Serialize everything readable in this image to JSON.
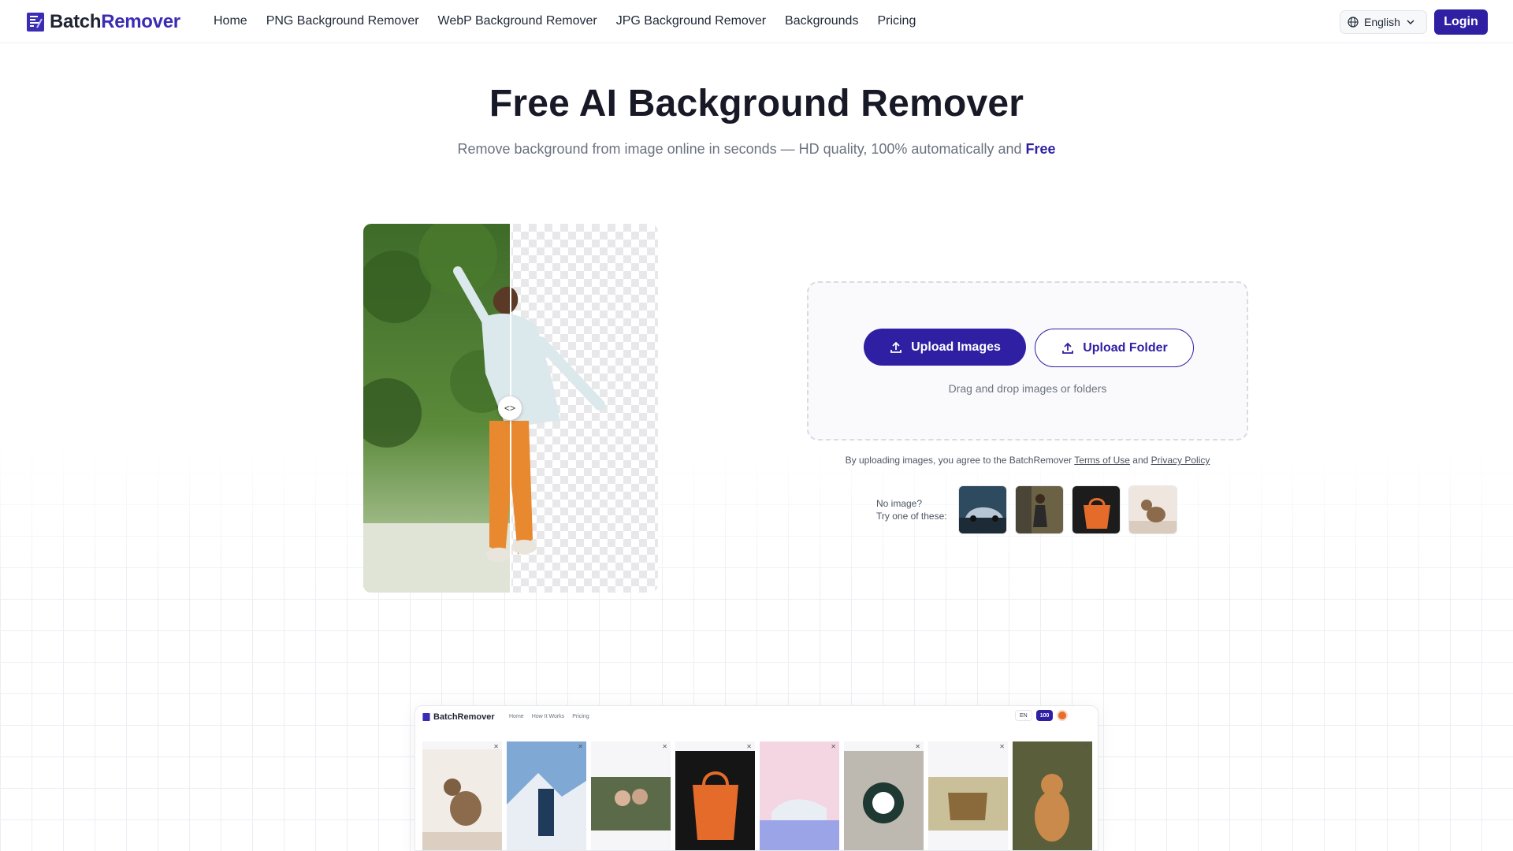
{
  "nav": {
    "logo_part1": "Batch",
    "logo_part2": "Remover",
    "links": [
      "Home",
      "PNG Background Remover",
      "WebP Background Remover",
      "JPG Background Remover",
      "Backgrounds",
      "Pricing"
    ],
    "language": "English",
    "login": "Login"
  },
  "hero": {
    "title": "Free AI Background Remover",
    "subtitle": "Remove background from image online in seconds — HD quality, 100% automatically and",
    "subtitle_highlight": "Free"
  },
  "upload": {
    "upload_images": "Upload Images",
    "upload_folder": "Upload Folder",
    "hint": "Drag and drop images or folders",
    "terms_prefix": "By uploading images, you agree to the BatchRemover",
    "terms_link": "Terms of Use",
    "terms_and": "and",
    "privacy_link": "Privacy Policy",
    "try_line1": "No image?",
    "try_line2": "Try one of these:"
  },
  "preview": {
    "logo": "BatchRemover",
    "links": [
      "Home",
      "How It Works",
      "Pricing"
    ],
    "lang": "EN",
    "credits": "100"
  },
  "colors": {
    "brand": "#2e1fa3",
    "title": "#171a26"
  }
}
